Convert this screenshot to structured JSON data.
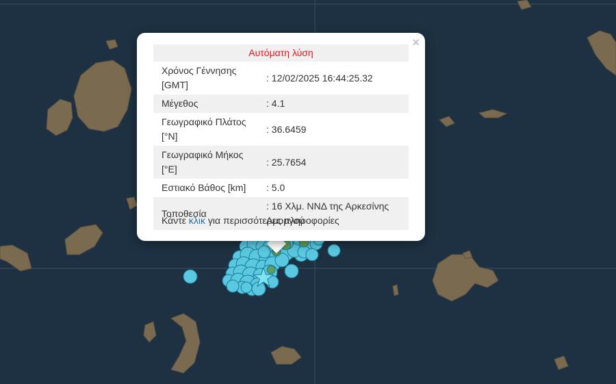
{
  "popup": {
    "close_label": "×",
    "title": "Αυτόματη λύση",
    "rows": [
      {
        "label": "Χρόνος Γέννησης [GMT]",
        "value": ": 12/02/2025 16:44:25.32"
      },
      {
        "label": "Μέγεθος",
        "value": ": 4.1"
      },
      {
        "label": "Γεωγραφικό Πλάτος [°N]",
        "value": ": 36.6459"
      },
      {
        "label": "Γεωγραφικό Μήκος [°E]",
        "value": ": 25.7654"
      },
      {
        "label": "Εστιακό Βάθος [km]",
        "value": ": 5.0"
      },
      {
        "label": "Τοποθεσία",
        "value": ": 16 Χλμ. ΝΝΔ της Αρκεσίνης Αμοργού"
      }
    ],
    "more_prefix": "Κάντε ",
    "more_link": "κλικ",
    "more_suffix": " για περισσότερες πληροφορίες"
  },
  "colors": {
    "sea": "#1d3142",
    "land": "#7a6a4f",
    "marker": "#5ac8e0",
    "marker_stroke": "#1b7a96",
    "marker_green": "#5f9e5a",
    "title_red": "#e3121b",
    "link_blue": "#1c6ca8"
  },
  "icons": {
    "close": "close-icon",
    "star": "star-marker-icon"
  }
}
